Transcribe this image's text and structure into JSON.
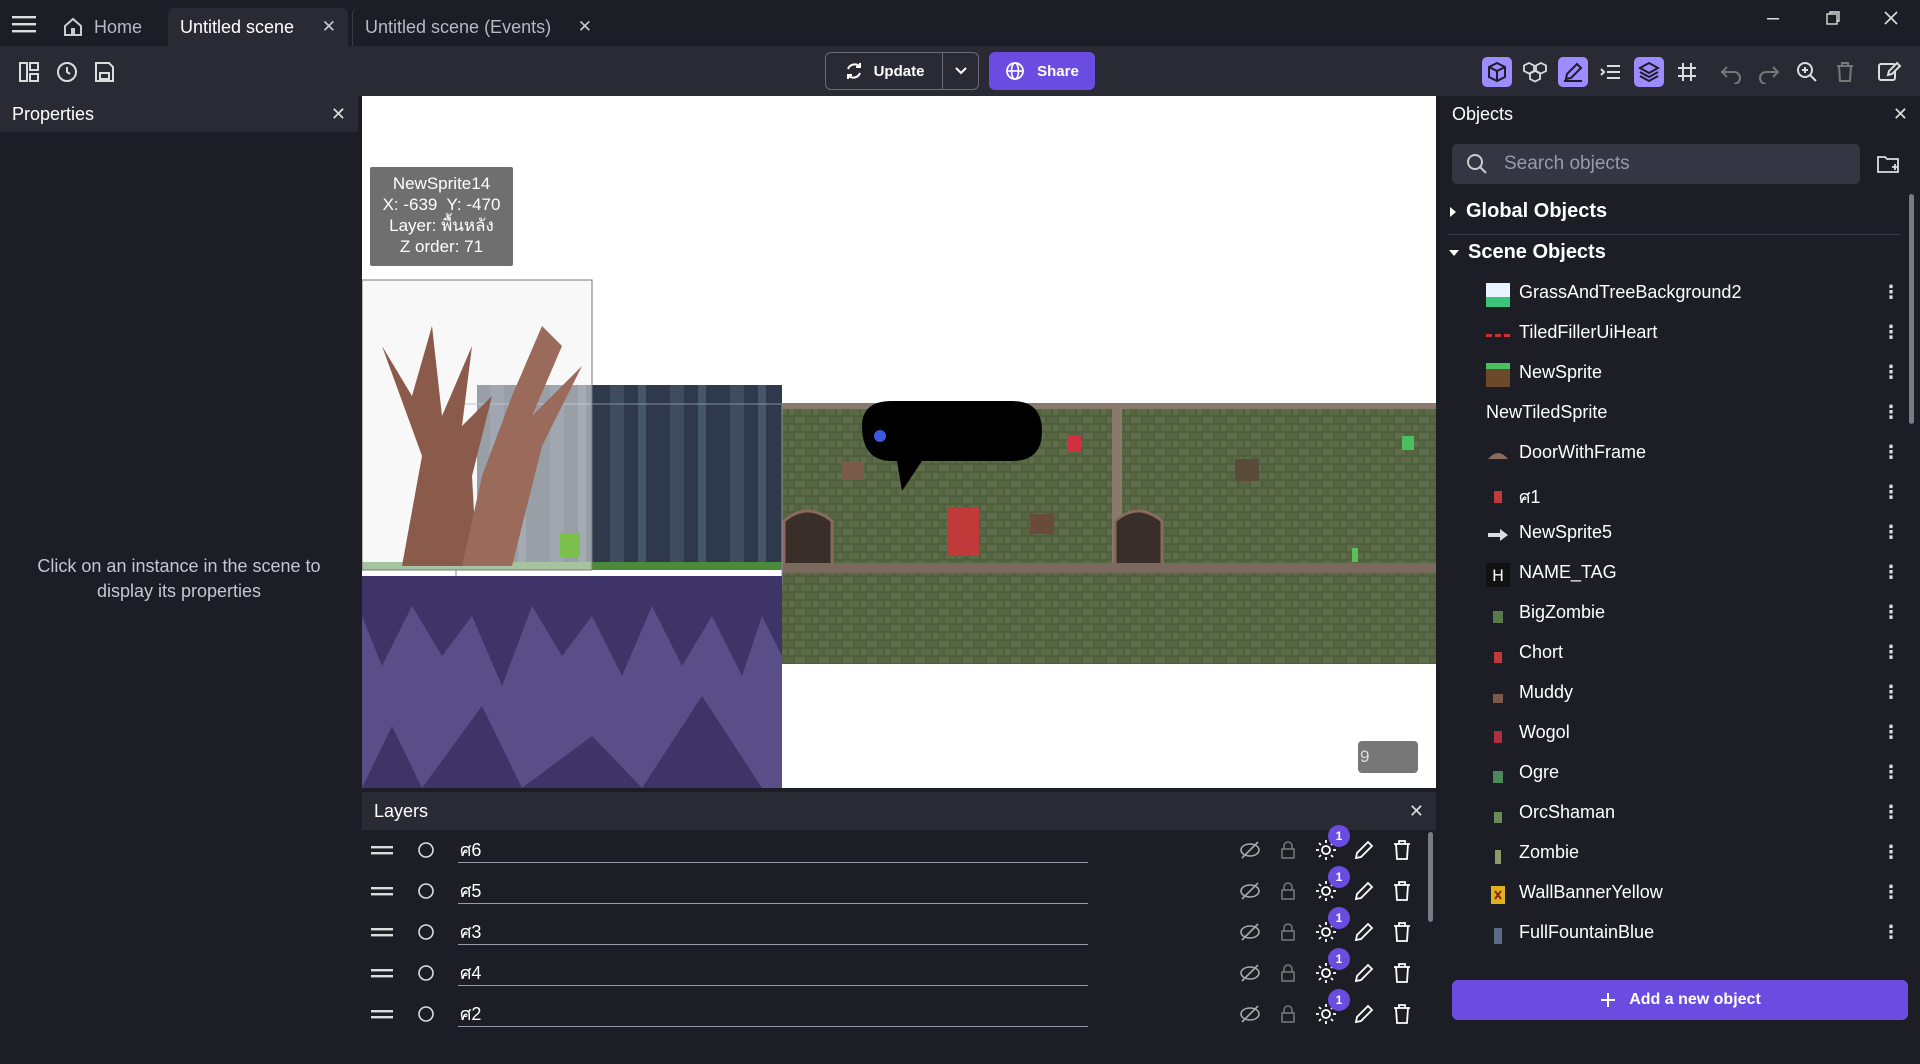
{
  "tabs": [
    {
      "label": "Home"
    },
    {
      "label": "Untitled scene"
    },
    {
      "label": "Untitled scene (Events)"
    }
  ],
  "toolbar": {
    "update_label": "Update",
    "share_label": "Share"
  },
  "properties": {
    "title": "Properties",
    "empty_message": "Click on an instance in the scene to display its properties"
  },
  "canvas": {
    "tooltip": {
      "name": "NewSprite14",
      "position": "X: -639  Y: -470",
      "layer": "Layer: พื้นหลัง",
      "z_order": "Z order: 71"
    },
    "small_counter": "9"
  },
  "layers": {
    "title": "Layers",
    "items": [
      {
        "name": "ศ6",
        "badge": "1"
      },
      {
        "name": "ศ5",
        "badge": "1"
      },
      {
        "name": "ศ3",
        "badge": "1"
      },
      {
        "name": "ศ4",
        "badge": "1"
      },
      {
        "name": "ศ2",
        "badge": "1"
      }
    ]
  },
  "objects": {
    "title": "Objects",
    "search_placeholder": "Search objects",
    "global_label": "Global Objects",
    "scene_label": "Scene Objects",
    "items": [
      {
        "name": "GrassAndTreeBackground2",
        "thumb_color": "#3cc47a"
      },
      {
        "name": "TiledFillerUiHeart",
        "thumb_color": "#d03030"
      },
      {
        "name": "NewSprite",
        "thumb_color": "#6a4a2a"
      },
      {
        "name": "NewTiledSprite",
        "thumb_color": ""
      },
      {
        "name": "DoorWithFrame",
        "thumb_color": "#8a6a5a"
      },
      {
        "name": "ศ1",
        "thumb_color": "#c03a3a"
      },
      {
        "name": "NewSprite5",
        "thumb_color": "#222222"
      },
      {
        "name": "NAME_TAG",
        "thumb_color": "#111111"
      },
      {
        "name": "BigZombie",
        "thumb_color": "#5a7a4a"
      },
      {
        "name": "Chort",
        "thumb_color": "#c03a3a"
      },
      {
        "name": "Muddy",
        "thumb_color": "#7a5a4a"
      },
      {
        "name": "Wogol",
        "thumb_color": "#b03040"
      },
      {
        "name": "Ogre",
        "thumb_color": "#4a8a5a"
      },
      {
        "name": "OrcShaman",
        "thumb_color": "#6a8a5a"
      },
      {
        "name": "Zombie",
        "thumb_color": "#8a9a6a"
      },
      {
        "name": "WallBannerYellow",
        "thumb_color": "#e0b020"
      },
      {
        "name": "FullFountainBlue",
        "thumb_color": "#5a6a8a"
      }
    ],
    "add_label": "Add a new object"
  },
  "colors": {
    "accent": "#6a4de0",
    "panel_bg": "#1d1d26",
    "toolbar_bg": "#2a2a35"
  }
}
